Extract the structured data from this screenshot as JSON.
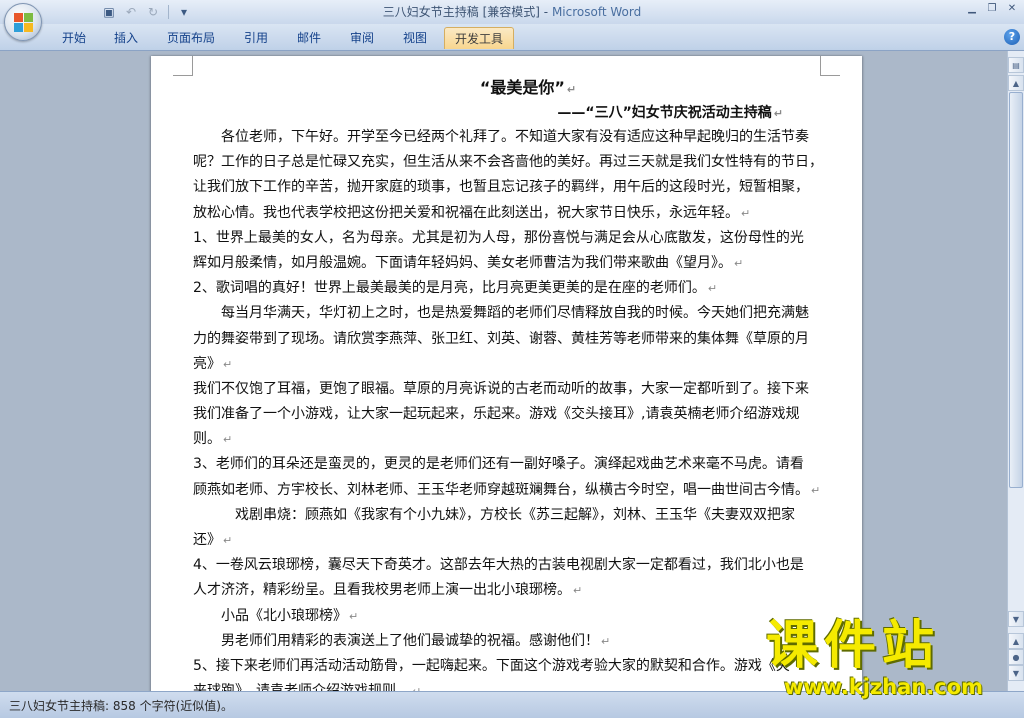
{
  "window": {
    "doc_name": "三八妇女节主持稿 [兼容模式]",
    "separator": " - ",
    "app_name": "Microsoft Word"
  },
  "quick_access": {
    "save_icon": "save-icon",
    "undo_icon": "undo-icon",
    "redo_icon": "redo-icon",
    "customize_icon": "customize-icon"
  },
  "ribbon": {
    "tabs": [
      {
        "label": "开始"
      },
      {
        "label": "插入"
      },
      {
        "label": "页面布局"
      },
      {
        "label": "引用"
      },
      {
        "label": "邮件"
      },
      {
        "label": "审阅"
      },
      {
        "label": "视图"
      },
      {
        "label": "开发工具",
        "active": true
      }
    ],
    "help_label": "?"
  },
  "document": {
    "title": "“最美是你”",
    "subtitle": "——“三八”妇女节庆祝活动主持稿",
    "lines": [
      "　　各位老师，下午好。开学至今已经两个礼拜了。不知道大家有没有适应这种早起晚归的生活节奏",
      "呢？工作的日子总是忙碌又充实，但生活从来不会吝啬他的美好。再过三天就是我们女性特有的节日，",
      "让我们放下工作的辛苦，抛开家庭的琐事，也暂且忘记孩子的羁绊，用午后的这段时光，短暂相聚，",
      "放松心情。我也代表学校把这份把关爱和祝福在此刻送出，祝大家节日快乐，永远年轻。",
      "1、世界上最美的女人，名为母亲。尤其是初为人母，那份喜悦与满足会从心底散发，这份母性的光",
      "辉如月般柔情，如月般温婉。下面请年轻妈妈、美女老师曹洁为我们带来歌曲《望月》。",
      "2、歌词唱的真好！世界上最美最美的是月亮，比月亮更美更美的是在座的老师们。",
      "　　每当月华满天，华灯初上之时，也是热爱舞蹈的老师们尽情释放自我的时候。今天她们把充满魅",
      "力的舞姿带到了现场。请欣赏李燕萍、张卫红、刘英、谢蓉、黄桂芳等老师带来的集体舞《草原的月",
      "亮》",
      "我们不仅饱了耳福，更饱了眼福。草原的月亮诉说的古老而动听的故事，大家一定都听到了。接下来",
      "我们准备了一个小游戏，让大家一起玩起来，乐起来。游戏《交头接耳》,请袁英楠老师介绍游戏规",
      "则。",
      "3、老师们的耳朵还是蛮灵的，更灵的是老师们还有一副好嗓子。演绎起戏曲艺术来毫不马虎。请看",
      "顾燕如老师、方宇校长、刘林老师、王玉华老师穿越斑斓舞台，纵横古今时空，唱一曲世间古今情。",
      "　　　戏剧串烧：顾燕如《我家有个小九妹》，方校长《苏三起解》，刘林、王玉华《夫妻双双把家",
      "还》",
      "4、一卷风云琅琊榜，囊尽天下奇英才。这部去年大热的古装电视剧大家一定都看过，我们北小也是",
      "人才济济，精彩纷呈。且看我校男老师上演一出北小琅琊榜。",
      "　　小品《北小琅琊榜》",
      "　　男老师们用精彩的表演送上了他们最诚挚的祝福。感谢他们！",
      "5、接下来老师们再活动活动筋骨，一起嗨起来。下面这个游戏考验大家的默契和合作。游戏《夹",
      "夹球跑》，请袁老师介绍游戏规则。"
    ],
    "para_end_lines": [
      3,
      5,
      6,
      9,
      12,
      14,
      16,
      18,
      19,
      20,
      22
    ],
    "para_mark": "↵"
  },
  "status_bar": {
    "text": "三八妇女节主持稿: 858 个字符(近似值)。"
  },
  "watermark": {
    "chinese": "课件站",
    "url": "www.kjzhan.com"
  }
}
